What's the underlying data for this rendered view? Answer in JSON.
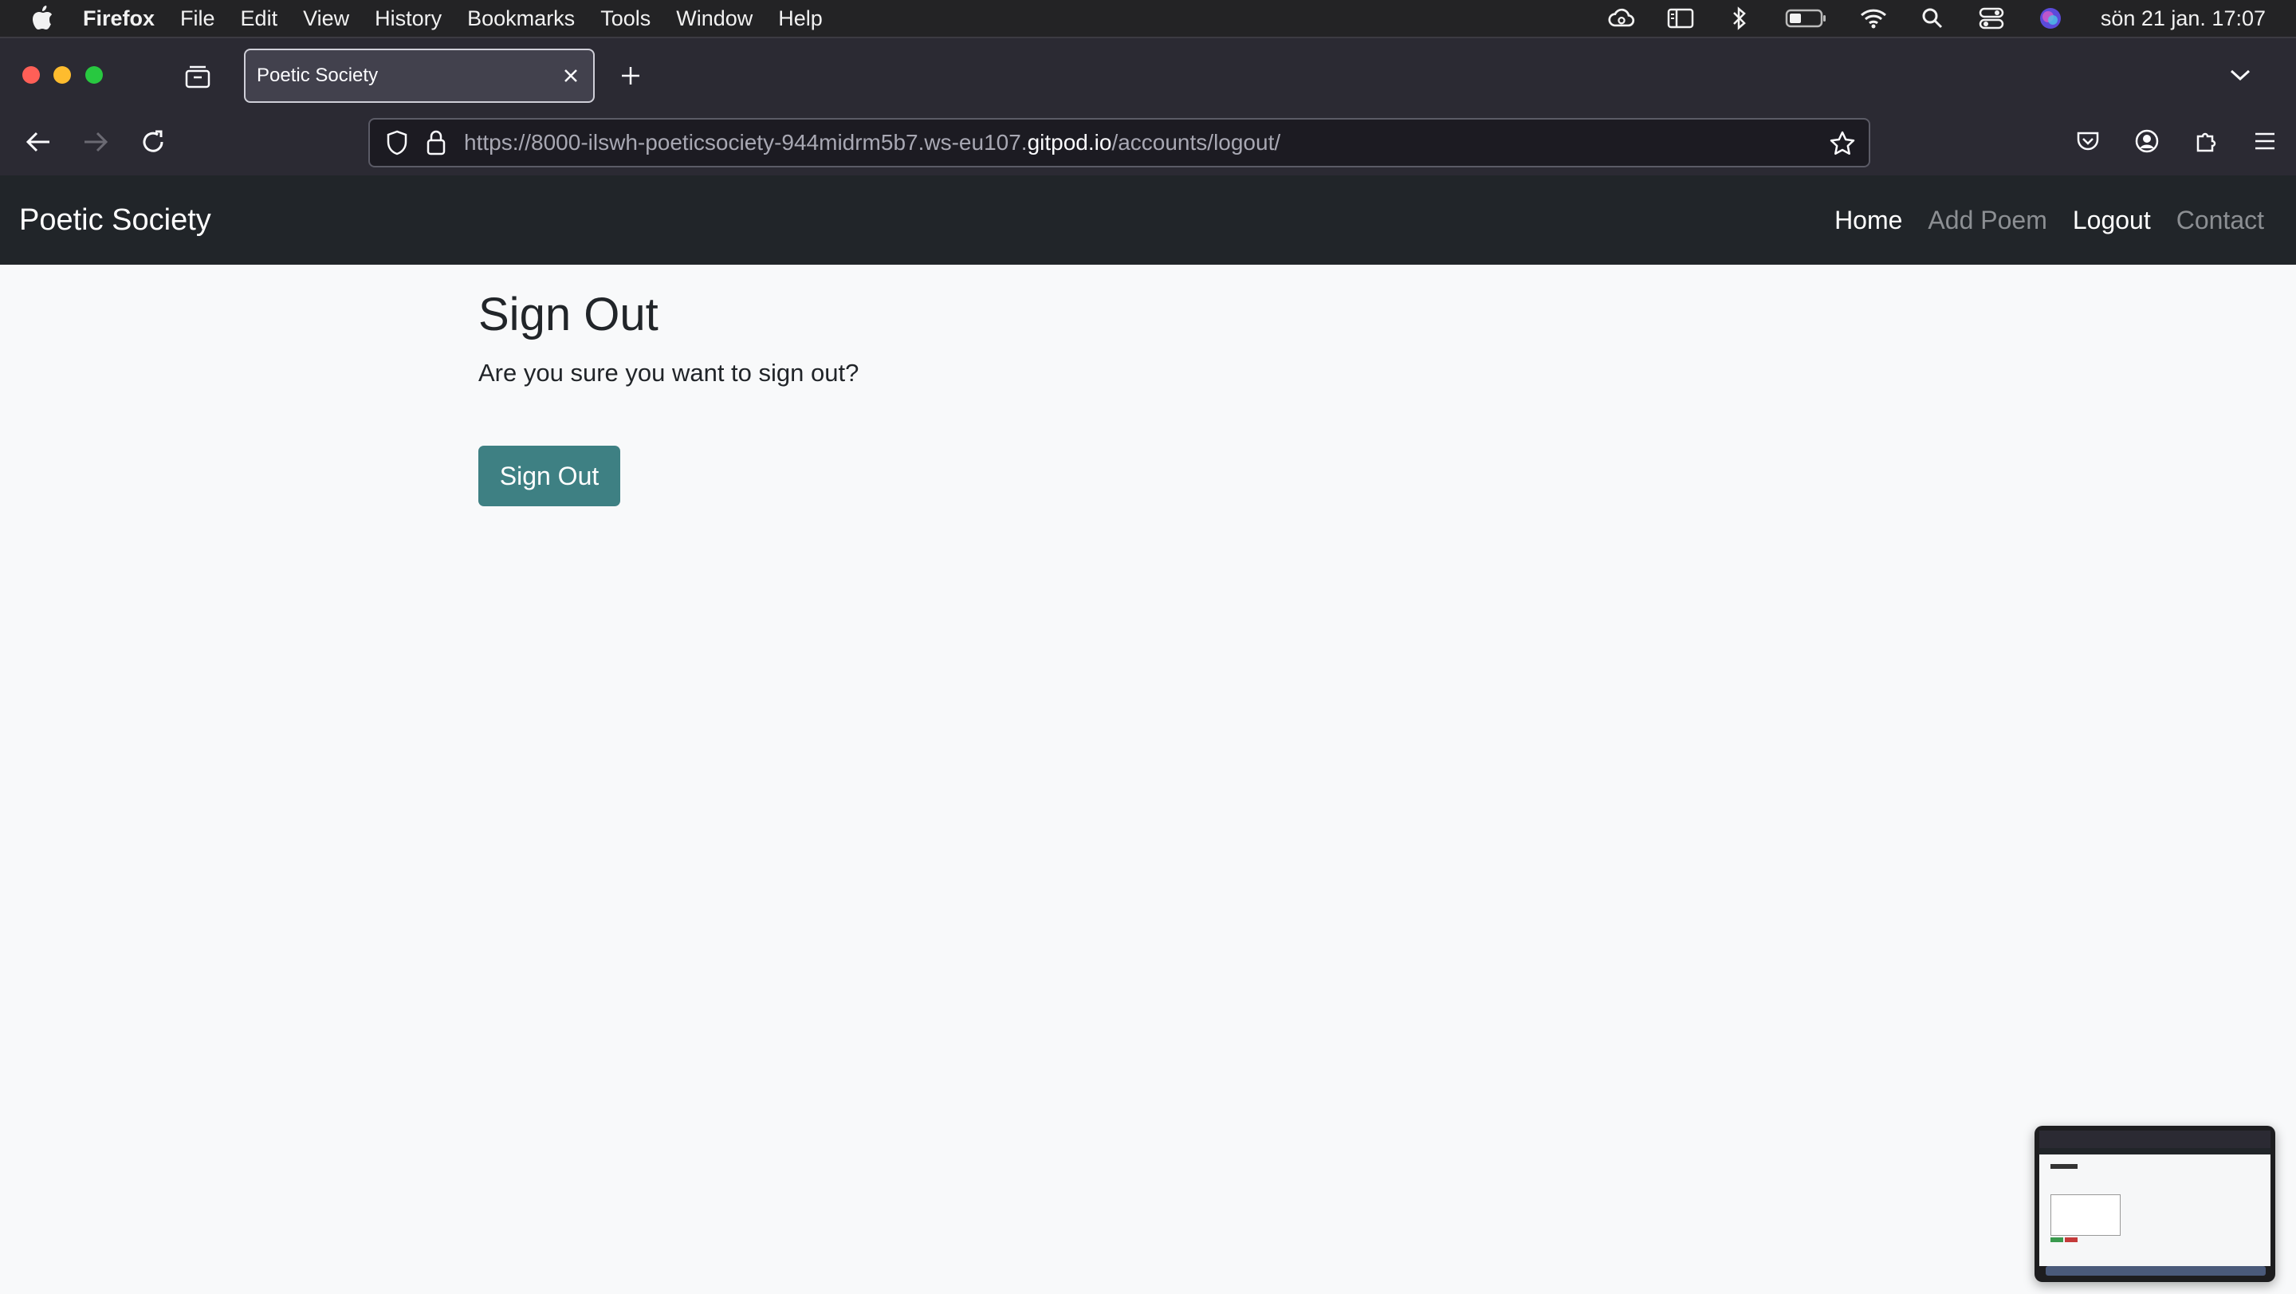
{
  "menubar": {
    "app_name": "Firefox",
    "items": [
      "File",
      "Edit",
      "View",
      "History",
      "Bookmarks",
      "Tools",
      "Window",
      "Help"
    ],
    "clock": "sön 21 jan. 17:07",
    "status_icons": [
      "creative-cloud-icon",
      "sidebar-icon",
      "bluetooth-icon",
      "battery-icon",
      "wifi-icon",
      "spotlight-search-icon",
      "control-center-icon",
      "siri-icon"
    ]
  },
  "browser": {
    "tab_title": "Poetic Society",
    "url_prefix": "https://8000-ilswh-poeticsociety-944midrm5b7.ws-eu107.",
    "url_domain": "gitpod.io",
    "url_path": "/accounts/logout/"
  },
  "site": {
    "brand": "Poetic Society",
    "nav": [
      {
        "label": "Home",
        "active": true
      },
      {
        "label": "Add Poem",
        "active": false
      },
      {
        "label": "Logout",
        "active": true
      },
      {
        "label": "Contact",
        "active": false
      }
    ]
  },
  "page": {
    "title": "Sign Out",
    "message": "Are you sure you want to sign out?",
    "button_label": "Sign Out"
  },
  "colors": {
    "navbar_bg": "#212529",
    "button_bg": "#3e8083",
    "page_bg": "#f8f9fa"
  }
}
